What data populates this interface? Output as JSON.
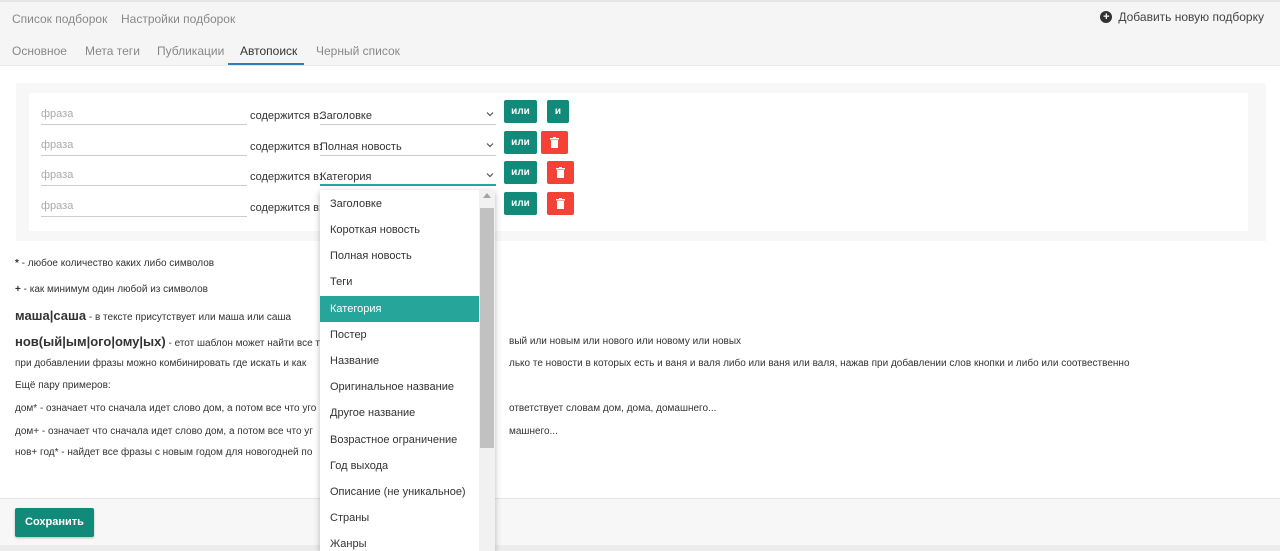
{
  "topbar": {
    "links": [
      "Список подборок",
      "Настройки подборок"
    ],
    "add_label": "Добавить новую подборку"
  },
  "tabs": [
    {
      "label": "Основное",
      "active": false
    },
    {
      "label": "Мета теги",
      "active": false
    },
    {
      "label": "Публикации",
      "active": false
    },
    {
      "label": "Автопоиск",
      "active": true
    },
    {
      "label": "Черный список",
      "active": false
    }
  ],
  "rules": {
    "phrase_placeholder": "фраза",
    "contains_label": "содержится в:",
    "or_label": "или",
    "and_label": "и",
    "rows": [
      {
        "field": "Заголовке"
      },
      {
        "field": "Полная новость"
      },
      {
        "field": "Категория"
      },
      {
        "field": ""
      }
    ]
  },
  "dropdown": {
    "options": [
      "Заголовке",
      "Короткая новость",
      "Полная новость",
      "Теги",
      "Категория",
      "Постер",
      "Название",
      "Оригинальное название",
      "Другое название",
      "Возрастное ограничение",
      "Год выхода",
      "Описание (не уникальное)",
      "Страны",
      "Жанры"
    ],
    "selected": "Категория"
  },
  "help": {
    "line1_sym": "*",
    "line1_text": " - любое количество каких либо символов",
    "line2_sym": "+",
    "line2_text": " - как минимум один любой из символов",
    "line3_sym": "маша|саша",
    "line3_text": " - в тексте присутствует или маша или саша",
    "line4_sym": "нов(ый|ым|ого|ому|ых)",
    "line4_text_a": " - етот шаблон может найти все т",
    "line4_text_b": "вый или новым или нового или новому или новых",
    "line5_a": "при добавлении фразы можно комбинировать где искать и как",
    "line5_b": "лько те новости в которых есть и ваня и валя либо или ваня или валя, нажав при добавлении слов кнопки и либо или соотвественно",
    "line6": "Ещё пару примеров:",
    "line7_a": "дом* - означает что сначала идет слово дом, а потом все что уго",
    "line7_b": "ответствует словам дом, дома, домашнего...",
    "line8_a": "дом+ - означает что сначала идет слово дом, а потом все что уг",
    "line8_b": "машнего...",
    "line9_a": "нов+ год* - найдет все фразы с новым годом для новогодней по"
  },
  "footer": {
    "save_label": "Сохранить"
  },
  "colors": {
    "accent": "#128a79",
    "selected_option": "#26a69a",
    "delete": "#f44336",
    "tab_underline": "#337ab7"
  }
}
